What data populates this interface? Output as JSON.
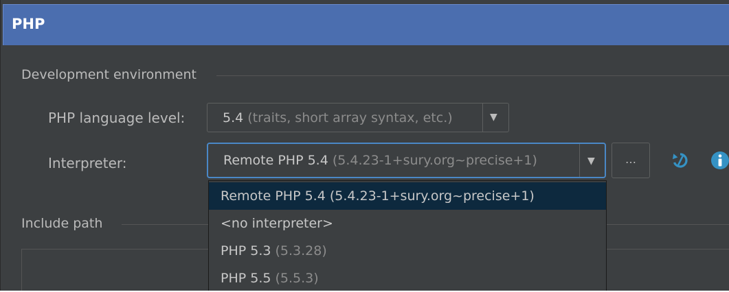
{
  "window": {
    "title": "PHP"
  },
  "dev_env": {
    "section_label": "Development environment",
    "language_level": {
      "label": "PHP language level:",
      "value_main": "5.4",
      "value_sub": "(traits, short array syntax, etc.)"
    },
    "interpreter": {
      "label": "Interpreter:",
      "value_main": "Remote PHP 5.4",
      "value_sub": "(5.4.23-1+sury.org~precise+1)",
      "more_button": "…"
    }
  },
  "include_path": {
    "section_label": "Include path"
  },
  "dropdown": {
    "items": [
      {
        "main": "Remote PHP 5.4 (5.4.23-1+sury.org~precise+1)",
        "sub": "",
        "selected": true
      },
      {
        "main": "<no interpreter>",
        "sub": "",
        "selected": false
      },
      {
        "main": "PHP 5.3",
        "sub": "(5.3.28)",
        "selected": false
      },
      {
        "main": "PHP 5.5",
        "sub": "(5.5.3)",
        "selected": false
      }
    ]
  },
  "icons": {
    "dropdown_arrow": "▼",
    "refresh": "refresh-icon",
    "info": "info-icon"
  },
  "colors": {
    "title_bar": "#4b6eaf",
    "panel": "#3c3f41",
    "focus": "#4a88c7",
    "selected_row": "#0d293e",
    "refresh_icon": "#3592c4",
    "info_icon": "#3592c4"
  }
}
